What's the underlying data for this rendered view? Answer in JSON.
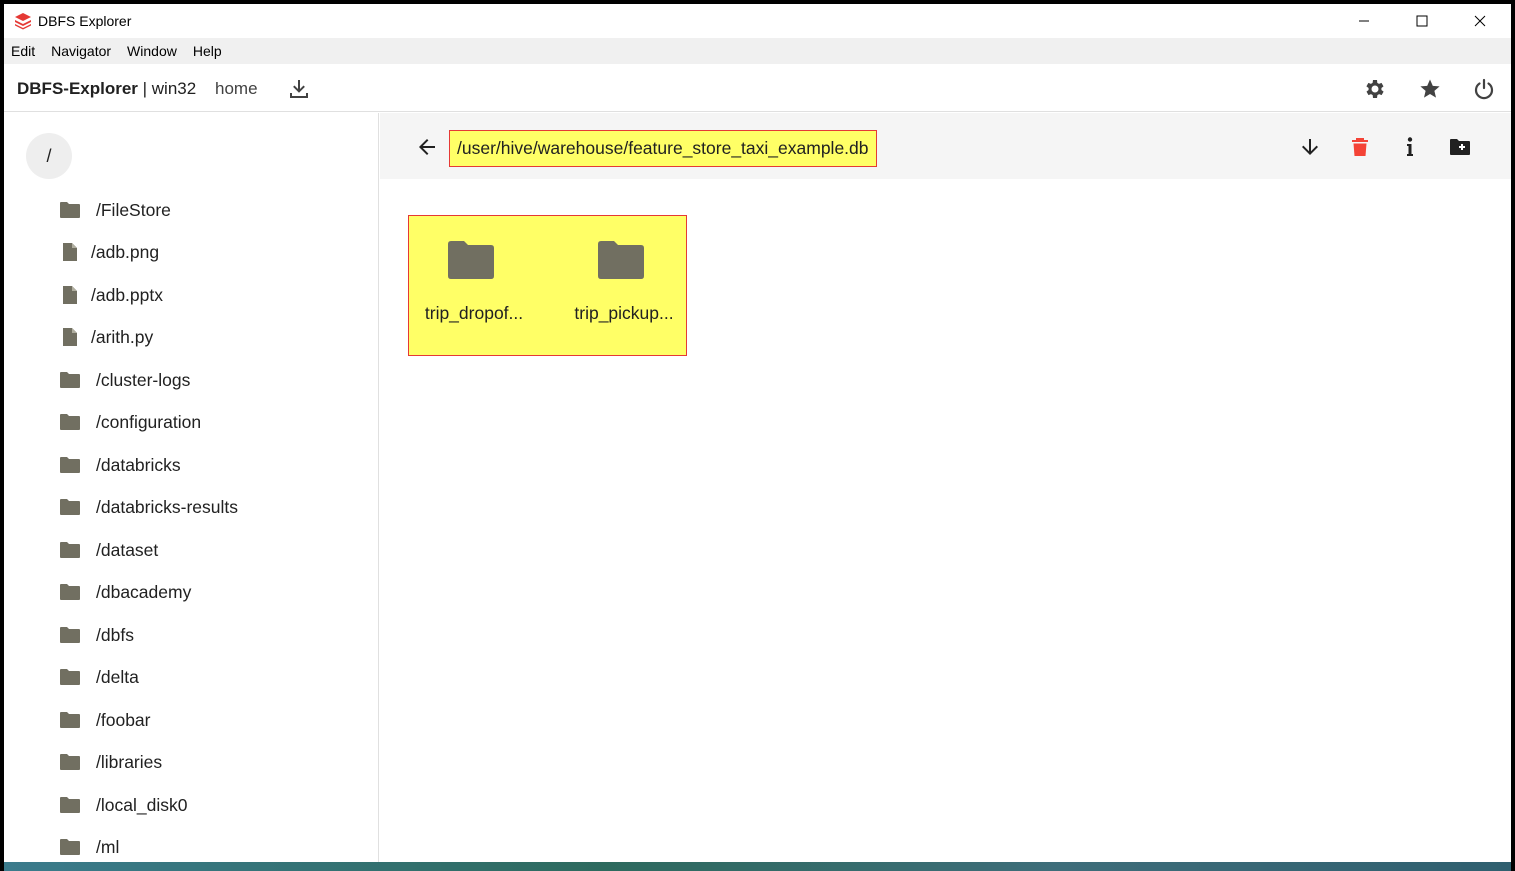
{
  "window": {
    "title": "DBFS Explorer"
  },
  "menu": {
    "items": [
      "Edit",
      "Navigator",
      "Window",
      "Help"
    ]
  },
  "toolbar": {
    "brand_bold": "DBFS-Explorer",
    "brand_suffix": " | win32",
    "home_label": "home"
  },
  "sidebar": {
    "root_label": "/",
    "items": [
      {
        "label": "/FileStore",
        "type": "folder"
      },
      {
        "label": "/adb.png",
        "type": "file"
      },
      {
        "label": "/adb.pptx",
        "type": "file"
      },
      {
        "label": "/arith.py",
        "type": "file"
      },
      {
        "label": "/cluster-logs",
        "type": "folder"
      },
      {
        "label": "/configuration",
        "type": "folder"
      },
      {
        "label": "/databricks",
        "type": "folder"
      },
      {
        "label": "/databricks-results",
        "type": "folder"
      },
      {
        "label": "/dataset",
        "type": "folder"
      },
      {
        "label": "/dbacademy",
        "type": "folder"
      },
      {
        "label": "/dbfs",
        "type": "folder"
      },
      {
        "label": "/delta",
        "type": "folder"
      },
      {
        "label": "/foobar",
        "type": "folder"
      },
      {
        "label": "/libraries",
        "type": "folder"
      },
      {
        "label": "/local_disk0",
        "type": "folder"
      },
      {
        "label": "/ml",
        "type": "folder"
      }
    ]
  },
  "main": {
    "path": "/user/hive/warehouse/feature_store_taxi_example.db",
    "items": [
      {
        "label": "trip_dropof...",
        "type": "folder"
      },
      {
        "label": "trip_pickup...",
        "type": "folder"
      }
    ]
  },
  "colors": {
    "highlight": "#ffff66",
    "highlight_border": "#e53935",
    "folder_icon": "#716f61",
    "delete_icon": "#f44336",
    "brand_red": "#e53935"
  }
}
